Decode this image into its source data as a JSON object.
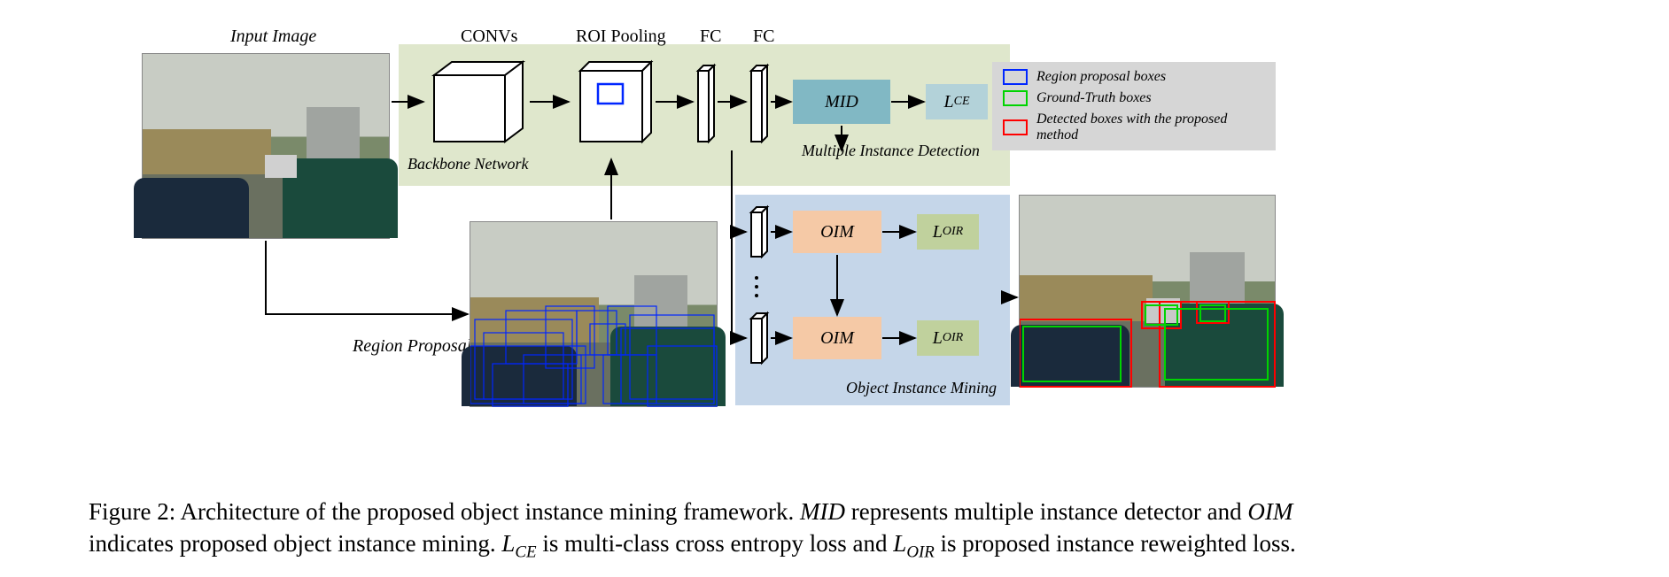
{
  "labels": {
    "input_image": "Input Image",
    "convs": "CONVs",
    "roi_pooling": "ROI Pooling",
    "fc1": "FC",
    "fc2": "FC",
    "backbone": "Backbone Network",
    "region_proposals": "Region Proposals",
    "mid_caption": "Multiple Instance Detection",
    "oim_caption": "Object Instance Mining"
  },
  "blocks": {
    "mid": "MID",
    "lce_prefix": "L",
    "lce_sub": "CE",
    "oim1": "OIM",
    "loir1_prefix": "L",
    "loir1_sub": "OIR",
    "oim2": "OIM",
    "loir2_prefix": "L",
    "loir2_sub": "OIR"
  },
  "legend": {
    "items": [
      {
        "color": "#0026ff",
        "text": "Region proposal boxes"
      },
      {
        "color": "#00d400",
        "text": "Ground-Truth boxes"
      },
      {
        "color": "#ff0000",
        "text": "Detected boxes with the proposed method"
      }
    ]
  },
  "caption": {
    "prefix": "Figure 2: Architecture of the proposed object instance mining framework. ",
    "mid_abbr": "MID",
    "mid_def": " represents multiple instance detector and ",
    "oim_abbr": "OIM",
    "oim_def_line1": " indicates proposed object instance mining. ",
    "lce_L": "L",
    "lce_sub": "CE",
    "lce_def": " is multi-class cross entropy loss and ",
    "loir_L": "L",
    "loir_sub": "OIR",
    "loir_def": " is proposed instance reweighted loss."
  }
}
